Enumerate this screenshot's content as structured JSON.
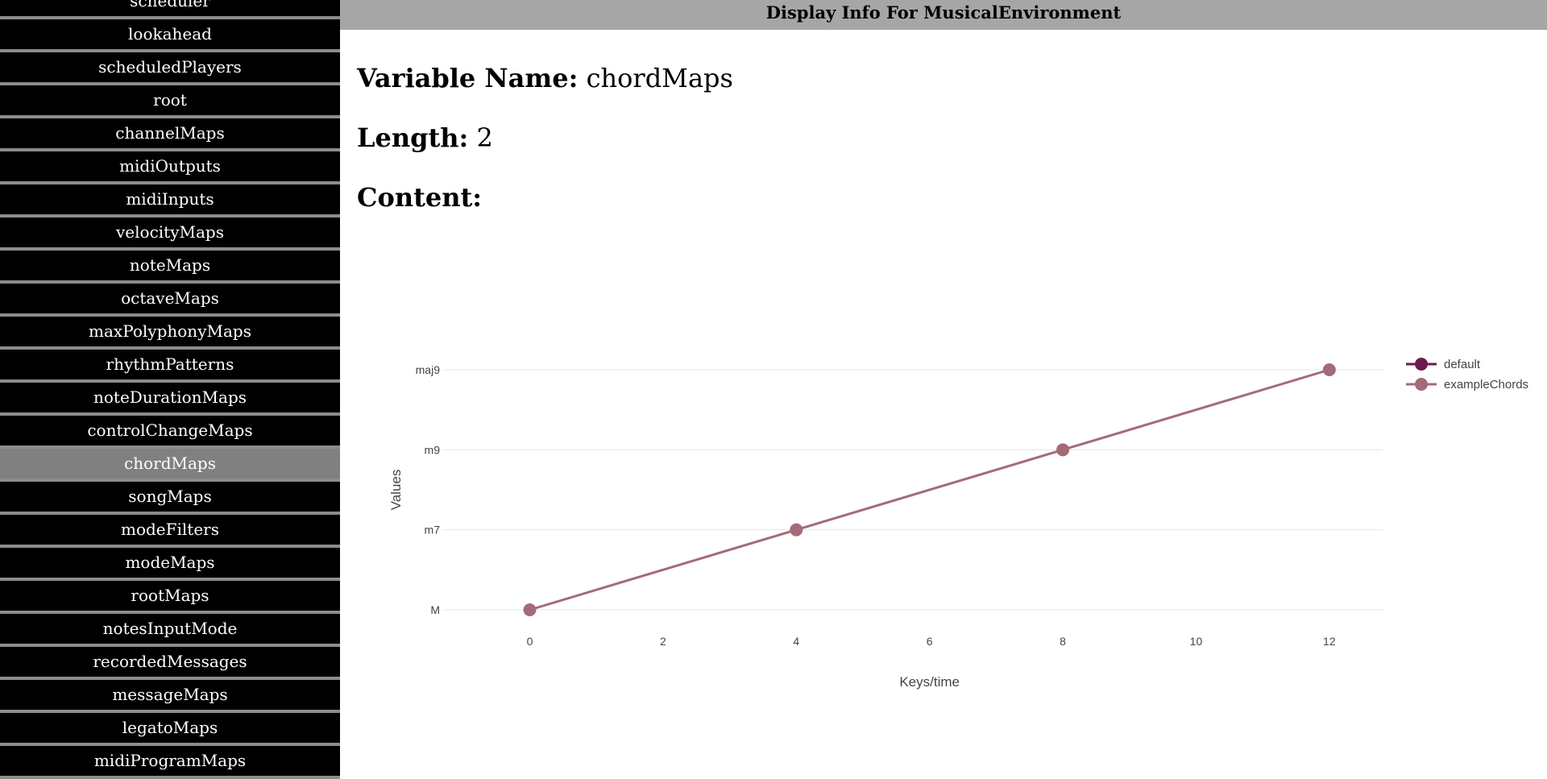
{
  "header": {
    "title": "Display Info For MusicalEnvironment"
  },
  "sidebar": {
    "active": "chordMaps",
    "items": [
      "scheduler",
      "lookahead",
      "scheduledPlayers",
      "root",
      "channelMaps",
      "midiOutputs",
      "midiInputs",
      "velocityMaps",
      "noteMaps",
      "octaveMaps",
      "maxPolyphonyMaps",
      "rhythmPatterns",
      "noteDurationMaps",
      "controlChangeMaps",
      "chordMaps",
      "songMaps",
      "modeFilters",
      "modeMaps",
      "rootMaps",
      "notesInputMode",
      "recordedMessages",
      "messageMaps",
      "legatoMaps",
      "midiProgramMaps"
    ]
  },
  "info": {
    "variable_label": "Variable Name:",
    "variable_value": "chordMaps",
    "length_label": "Length:",
    "length_value": "2",
    "content_label": "Content:"
  },
  "chart_data": {
    "type": "line",
    "xlabel": "Keys/time",
    "ylabel": "Values",
    "x_ticks": [
      0,
      2,
      4,
      6,
      8,
      10,
      12
    ],
    "xlim": [
      -1.3,
      12.8
    ],
    "y_categories": [
      "M",
      "m7",
      "m9",
      "maj9"
    ],
    "legend_position": "top-right",
    "grid": "horizontal",
    "series": [
      {
        "name": "default",
        "color": "#6b1a4f",
        "points": []
      },
      {
        "name": "exampleChords",
        "color": "#a36b77",
        "points": [
          {
            "x": 0,
            "y": "M"
          },
          {
            "x": 4,
            "y": "m7"
          },
          {
            "x": 8,
            "y": "m9"
          },
          {
            "x": 12,
            "y": "maj9"
          }
        ]
      }
    ]
  }
}
